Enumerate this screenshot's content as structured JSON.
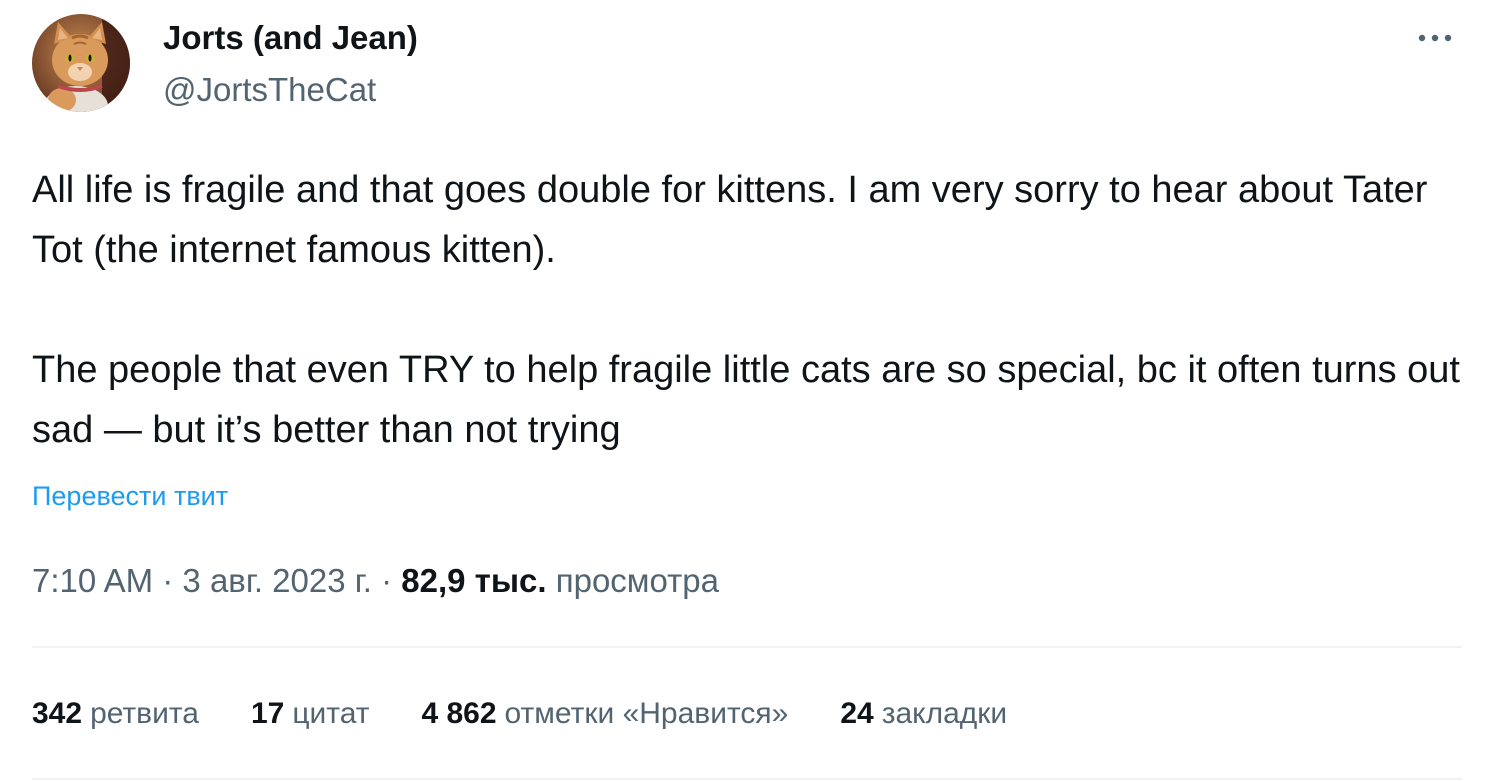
{
  "author": {
    "name": "Jorts (and Jean)",
    "handle": "@JortsTheCat"
  },
  "tweet": {
    "paragraphs": [
      "All life is fragile and that goes double for kittens. I am very sorry to hear about Tater Tot (the internet famous kitten).",
      "The people that even TRY to help fragile little cats are so special, bc it often turns out sad — but it’s better than not trying"
    ],
    "translate_label": "Перевести твит"
  },
  "meta": {
    "time": "7:10 AM",
    "separator": "·",
    "date": "3 авг. 2023 г.",
    "views_count": "82,9 тыс.",
    "views_label": "просмотра"
  },
  "stats": {
    "retweets": {
      "count": "342",
      "label": "ретвита"
    },
    "quotes": {
      "count": "17",
      "label": "цитат"
    },
    "likes": {
      "count": "4 862",
      "label": "отметки «Нравится»"
    },
    "bookmarks": {
      "count": "24",
      "label": "закладки"
    }
  },
  "colors": {
    "text_primary": "#0f1419",
    "text_secondary": "#536471",
    "link": "#1d9bf0",
    "divider": "#eff3f4"
  },
  "icons": {
    "more": "more-dots-icon"
  }
}
